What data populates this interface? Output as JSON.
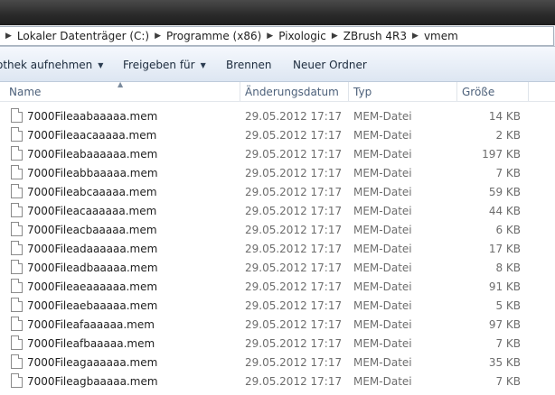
{
  "breadcrumb": [
    "Lokaler Datenträger (C:)",
    "Programme (x86)",
    "Pixologic",
    "ZBrush 4R3",
    "vmem"
  ],
  "toolbar": {
    "library": "othek aufnehmen",
    "share": "Freigeben für",
    "burn": "Brennen",
    "new_folder": "Neuer Ordner"
  },
  "columns": {
    "name": "Name",
    "date": "Änderungsdatum",
    "type": "Typ",
    "size": "Größe"
  },
  "files": [
    {
      "name": "7000Fileaabaaaaa.mem",
      "date": "29.05.2012 17:17",
      "type": "MEM-Datei",
      "size": "14 KB"
    },
    {
      "name": "7000Fileaacaaaaa.mem",
      "date": "29.05.2012 17:17",
      "type": "MEM-Datei",
      "size": "2 KB"
    },
    {
      "name": "7000Fileabaaaaaa.mem",
      "date": "29.05.2012 17:17",
      "type": "MEM-Datei",
      "size": "197 KB"
    },
    {
      "name": "7000Fileabbaaaaa.mem",
      "date": "29.05.2012 17:17",
      "type": "MEM-Datei",
      "size": "7 KB"
    },
    {
      "name": "7000Fileabcaaaaa.mem",
      "date": "29.05.2012 17:17",
      "type": "MEM-Datei",
      "size": "59 KB"
    },
    {
      "name": "7000Fileacaaaaaa.mem",
      "date": "29.05.2012 17:17",
      "type": "MEM-Datei",
      "size": "44 KB"
    },
    {
      "name": "7000Fileacbaaaaa.mem",
      "date": "29.05.2012 17:17",
      "type": "MEM-Datei",
      "size": "6 KB"
    },
    {
      "name": "7000Fileadaaaaaa.mem",
      "date": "29.05.2012 17:17",
      "type": "MEM-Datei",
      "size": "17 KB"
    },
    {
      "name": "7000Fileadbaaaaa.mem",
      "date": "29.05.2012 17:17",
      "type": "MEM-Datei",
      "size": "8 KB"
    },
    {
      "name": "7000Fileaeaaaaaa.mem",
      "date": "29.05.2012 17:17",
      "type": "MEM-Datei",
      "size": "91 KB"
    },
    {
      "name": "7000Fileaebaaaaa.mem",
      "date": "29.05.2012 17:17",
      "type": "MEM-Datei",
      "size": "5 KB"
    },
    {
      "name": "7000Fileafaaaaaa.mem",
      "date": "29.05.2012 17:17",
      "type": "MEM-Datei",
      "size": "97 KB"
    },
    {
      "name": "7000Fileafbaaaaa.mem",
      "date": "29.05.2012 17:17",
      "type": "MEM-Datei",
      "size": "7 KB"
    },
    {
      "name": "7000Fileagaaaaaa.mem",
      "date": "29.05.2012 17:17",
      "type": "MEM-Datei",
      "size": "35 KB"
    },
    {
      "name": "7000Fileagbaaaaa.mem",
      "date": "29.05.2012 17:17",
      "type": "MEM-Datei",
      "size": "7 KB"
    }
  ]
}
